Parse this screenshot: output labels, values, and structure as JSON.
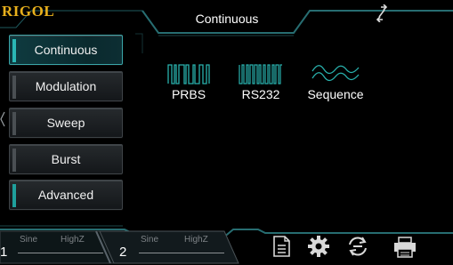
{
  "logo": "RIGOL",
  "header": {
    "title": "Continuous",
    "swap_icon": "swap-arrows-icon"
  },
  "menu": {
    "items": [
      {
        "label": "Continuous",
        "state": "selected"
      },
      {
        "label": "Modulation",
        "state": "normal"
      },
      {
        "label": "Sweep",
        "state": "normal"
      },
      {
        "label": "Burst",
        "state": "normal"
      },
      {
        "label": "Advanced",
        "state": "normal"
      }
    ]
  },
  "waveforms": [
    {
      "label": "PRBS",
      "icon": "prbs-wave-icon"
    },
    {
      "label": "RS232",
      "icon": "rs232-wave-icon"
    },
    {
      "label": "Sequence",
      "icon": "sequence-wave-icon"
    }
  ],
  "channels": [
    {
      "number": "1",
      "waveform": "Sine",
      "impedance": "HighZ"
    },
    {
      "number": "2",
      "waveform": "Sine",
      "impedance": "HighZ"
    }
  ],
  "toolbar": {
    "icons": [
      "file-icon",
      "gear-icon",
      "sync-icon",
      "printer-icon"
    ]
  },
  "colors": {
    "accent": "#2ab7b5",
    "logo": "#e8b01c",
    "frame": "#2f6f73"
  }
}
